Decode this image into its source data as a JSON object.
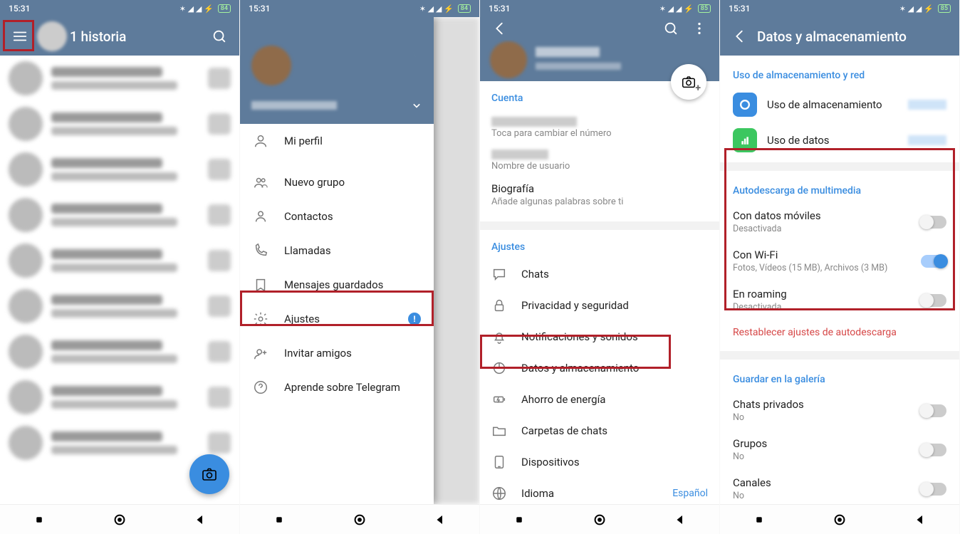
{
  "status": {
    "time": "15:31",
    "battery": "84",
    "battery2": "85"
  },
  "s1": {
    "title": "1 historia"
  },
  "drawer": {
    "items": [
      {
        "label": "Mi perfil"
      },
      {
        "label": "Nuevo grupo"
      },
      {
        "label": "Contactos"
      },
      {
        "label": "Llamadas"
      },
      {
        "label": "Mensajes guardados"
      },
      {
        "label": "Ajustes",
        "badge": "!"
      },
      {
        "label": "Invitar amigos"
      },
      {
        "label": "Aprende sobre Telegram"
      }
    ]
  },
  "s3": {
    "account_title": "Cuenta",
    "phone_sub": "Toca para cambiar el número",
    "user_sub": "Nombre de usuario",
    "bio": "Biografía",
    "bio_sub": "Añade algunas palabras sobre ti",
    "ajustes": "Ajustes",
    "items": [
      {
        "label": "Chats"
      },
      {
        "label": "Privacidad y seguridad"
      },
      {
        "label": "Notificaciones y sonidos"
      },
      {
        "label": "Datos y almacenamiento"
      },
      {
        "label": "Ahorro de energía"
      },
      {
        "label": "Carpetas de chats"
      },
      {
        "label": "Dispositivos"
      },
      {
        "label": "Idioma",
        "value": "Español"
      }
    ]
  },
  "s4": {
    "title": "Datos y almacenamiento",
    "sec1": "Uso de almacenamiento y red",
    "storage": "Uso de almacenamiento",
    "data": "Uso de datos",
    "sec2": "Autodescarga de multimedia",
    "opt1": {
      "t": "Con datos móviles",
      "s": "Desactivada"
    },
    "opt2": {
      "t": "Con Wi-Fi",
      "s": "Fotos, Vídeos (15 MB), Archivos (3 MB)"
    },
    "opt3": {
      "t": "En roaming",
      "s": "Desactivada"
    },
    "reset": "Restablecer ajustes de autodescarga",
    "sec3": "Guardar en la galería",
    "g1": {
      "t": "Chats privados",
      "s": "No"
    },
    "g2": {
      "t": "Grupos",
      "s": "No"
    },
    "g3": {
      "t": "Canales",
      "s": "No"
    }
  }
}
